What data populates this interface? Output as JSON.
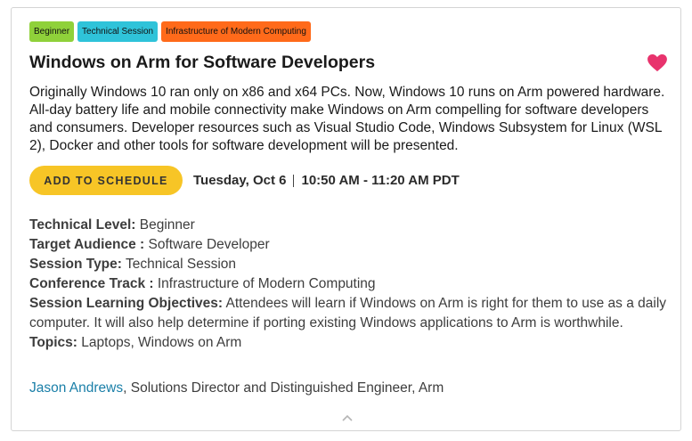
{
  "tags": [
    {
      "label": "Beginner",
      "color": "#8fd13a"
    },
    {
      "label": "Technical Session",
      "color": "#2fc3d9"
    },
    {
      "label": "Infrastructure of Modern Computing",
      "color": "#ff6a1a"
    }
  ],
  "session": {
    "title": "Windows on Arm for Software Developers",
    "description": "Originally Windows 10 ran only on x86 and x64 PCs. Now, Windows 10 runs on Arm powered hardware. All-day battery life and mobile connectivity make Windows on Arm compelling for software developers and consumers. Developer resources such as Visual Studio Code, Windows Subsystem for Linux (WSL 2), Docker and other tools for software development will be presented.",
    "favorite_icon": "heart-icon",
    "favorite_color": "#e8336d"
  },
  "schedule": {
    "button_label": "ADD TO SCHEDULE",
    "button_color": "#f7c526",
    "date": "Tuesday, Oct 6",
    "time": "10:50 AM - 11:20 AM PDT"
  },
  "details": [
    {
      "label": "Technical Level:",
      "value": "Beginner"
    },
    {
      "label": "Target Audience :",
      "value": "Software Developer"
    },
    {
      "label": "Session Type:",
      "value": "Technical Session"
    },
    {
      "label": "Conference Track :",
      "value": "Infrastructure of Modern Computing"
    },
    {
      "label": "Session Learning Objectives:",
      "value": "Attendees will learn if Windows on Arm is right for them to use as a daily computer. It will also help determine if porting existing Windows applications to Arm is worthwhile."
    },
    {
      "label": "Topics:",
      "value": "Laptops, Windows on Arm"
    }
  ],
  "speaker": {
    "name": "Jason Andrews",
    "role": ", Solutions Director and Distinguished Engineer, Arm",
    "link_color": "#1a7fa8"
  },
  "collapse_icon": "chevron-up-icon"
}
